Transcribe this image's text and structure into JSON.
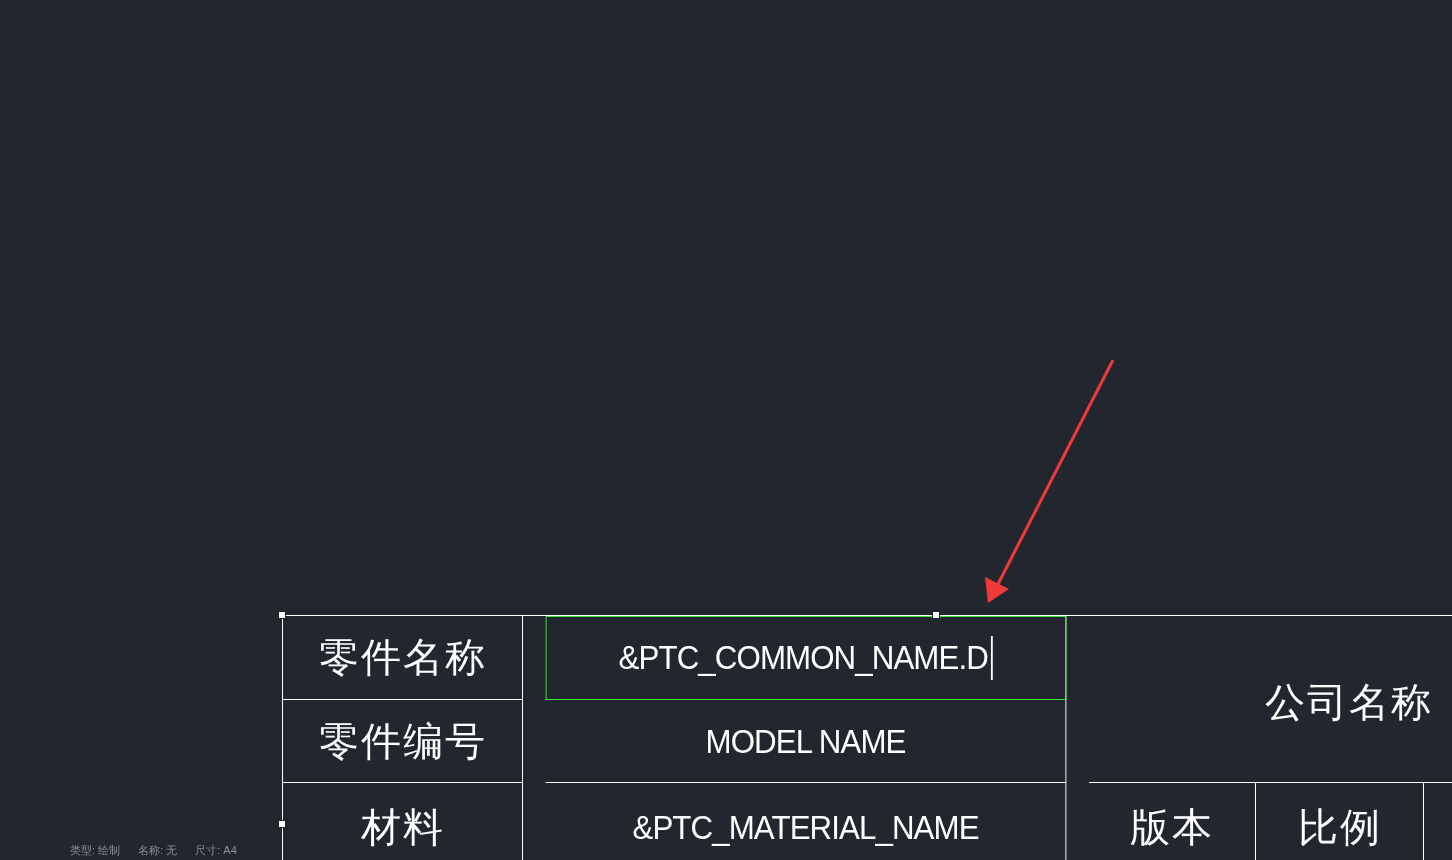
{
  "title_block": {
    "selected": true,
    "cells": [
      {
        "kind": "label",
        "text": "零件名称"
      },
      {
        "kind": "value",
        "text": "&PTC_COMMON_NAME.D",
        "editing": true
      },
      {
        "kind": "company",
        "text": "公司名称"
      },
      {
        "kind": "label",
        "text": "零件编号"
      },
      {
        "kind": "value",
        "text": "MODEL NAME",
        "editing": false
      },
      {
        "kind": "label",
        "text": "材料"
      },
      {
        "kind": "value",
        "text": "&PTC_MATERIAL_NAME",
        "editing": false
      },
      {
        "kind": "label",
        "text": "版本"
      },
      {
        "kind": "label",
        "text": "比例"
      }
    ]
  },
  "status_bar": [
    "类型: 绘制",
    "名称: 无",
    "尺寸: A4"
  ]
}
